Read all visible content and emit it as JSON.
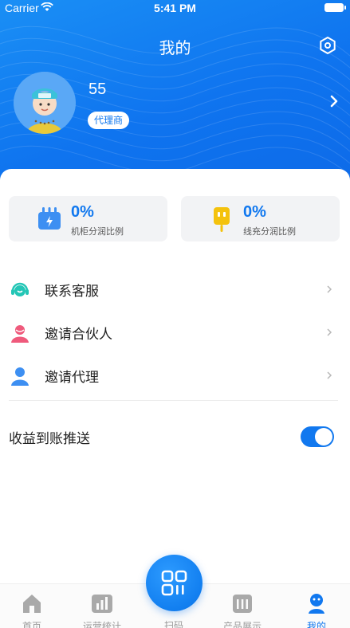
{
  "status_bar": {
    "carrier": "Carrier",
    "time": "5:41 PM"
  },
  "header": {
    "title": "我的"
  },
  "profile": {
    "username": "55",
    "role": "代理商"
  },
  "stats": [
    {
      "value": "0%",
      "label": "机柜分润比例",
      "icon": "cabinet-icon",
      "color": "#3d8ff2"
    },
    {
      "value": "0%",
      "label": "线充分润比例",
      "icon": "plug-icon",
      "color": "#f4c20d"
    }
  ],
  "menu": [
    {
      "label": "联系客服",
      "icon": "customer-service-icon",
      "color": "#24c6b6"
    },
    {
      "label": "邀请合伙人",
      "icon": "partner-icon",
      "color": "#ef5a7c"
    },
    {
      "label": "邀请代理",
      "icon": "agent-icon",
      "color": "#3d8ff2"
    }
  ],
  "push": {
    "label": "收益到账推送",
    "enabled": true
  },
  "tabs": [
    {
      "label": "首页",
      "icon": "home-icon",
      "active": false
    },
    {
      "label": "运营统计",
      "icon": "stats-icon",
      "active": false
    },
    {
      "label": "扫码",
      "icon": "scan-icon",
      "active": false
    },
    {
      "label": "产品展示",
      "icon": "products-icon",
      "active": false
    },
    {
      "label": "我的",
      "icon": "profile-icon",
      "active": true
    }
  ],
  "colors": {
    "accent": "#1178ef",
    "header": "#0f74ef"
  }
}
